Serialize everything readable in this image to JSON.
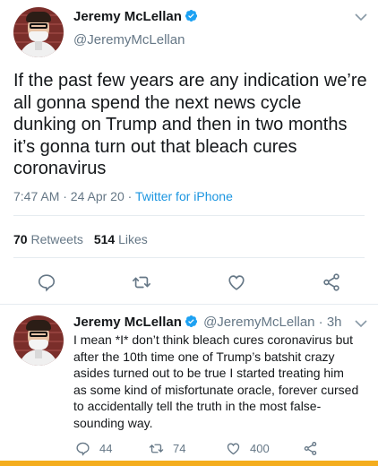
{
  "main_tweet": {
    "author_name": "Jeremy McLellan",
    "handle": "@JeremyMcLellan",
    "text": "If the past few years are any indication we’re all gonna spend the next news cycle dunking on Trump and then in two months it’s gonna turn out that bleach cures coronavirus",
    "time_date": "7:47 AM · 24 Apr 20 · ",
    "source": "Twitter for iPhone",
    "retweets_count": "70",
    "retweets_label": "Retweets",
    "likes_count": "514",
    "likes_label": "Likes"
  },
  "reply_tweet": {
    "author_name": "Jeremy McLellan",
    "handle_time": "@JeremyMcLellan · 3h",
    "text": "I mean *I* don’t think bleach cures coronavirus but after the 10th time one of Trump’s batshit crazy asides turned out to be true I started treating him as some kind of misfortunate oracle, forever cursed to accidentally tell the truth in the most false-sounding way.",
    "reply_count": "44",
    "retweet_count": "74",
    "like_count": "400"
  },
  "icons": {
    "verified": "verified-badge-icon",
    "reply": "reply-icon",
    "retweet": "retweet-icon",
    "like": "heart-icon",
    "share": "share-icon",
    "more": "chevron-down-icon"
  },
  "colors": {
    "text": "#14171a",
    "secondary": "#657786",
    "link": "#1b95e0",
    "verified": "#1da1f2",
    "bottom_bar": "#f4ad1e"
  }
}
